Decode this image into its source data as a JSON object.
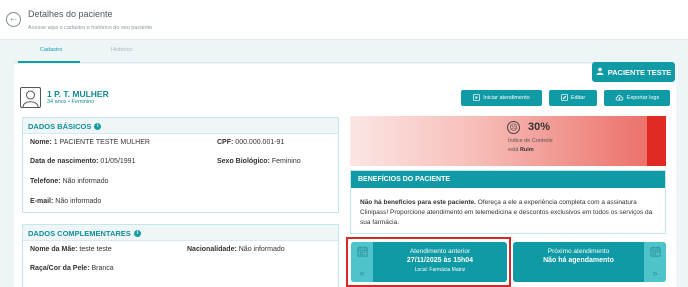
{
  "header": {
    "title": "Detalhes do paciente",
    "subtitle": "Acesse aqui o cadastro e histórico do seu paciente"
  },
  "tabs": [
    {
      "label": "Cadastro",
      "active": true
    },
    {
      "label": "Histórico",
      "active": false
    }
  ],
  "patient": {
    "button_label": "PACIENTE TESTE",
    "name": "1 P. T. MULHER",
    "age_sex": "34 anos • Feminino"
  },
  "actions": {
    "start_label": "Iniciar atendimento",
    "edit_label": "Editar",
    "export_label": "Exportar logs"
  },
  "dados_basicos": {
    "title": "DADOS BÁSICOS",
    "nome_label": "Nome:",
    "nome_value": "1 PACIENTE TESTE MULHER",
    "cpf_label": "CPF:",
    "cpf_value": "000.000.001-91",
    "nascimento_label": "Data de nascimento:",
    "nascimento_value": "01/05/1991",
    "sexo_label": "Sexo Biológico:",
    "sexo_value": "Feminino",
    "telefone_label": "Telefone:",
    "telefone_value": "Não informado",
    "email_label": "E-mail:",
    "email_value": "Não informado"
  },
  "dados_complementares": {
    "title": "DADOS COMPLEMENTARES",
    "mae_label": "Nome da Mãe:",
    "mae_value": "teste teste",
    "nacionalidade_label": "Nacionalidade:",
    "nacionalidade_value": "Não informado",
    "raca_label": "Raça/Cor da Pele:",
    "raca_value": "Branca"
  },
  "control_index": {
    "percent": "30%",
    "label": "Índice de Controle",
    "status_prefix": "está",
    "status": "Ruim",
    "colors": {
      "low": "#fbe6e4",
      "high": "#e02b22"
    }
  },
  "benefits": {
    "title": "BENEFÍCIOS DO PACIENTE",
    "text_bold": "Não há benefícios para este paciente.",
    "text_rest": " Ofereça a ele a experiência completa com a assinatura Clinipass! Proporcione atendimento em telemedicina e descontos exclusivos em todos os serviços da sua farmácia."
  },
  "appointments": {
    "previous": {
      "title": "Atendimento anterior",
      "date": "27/11/2025 às 15h04",
      "location": "Local: Farmácia Matriz"
    },
    "next": {
      "title": "Próximo atendimento",
      "date": "Não há agendamento"
    }
  },
  "icons": {
    "back": "arrow-left-circle",
    "avatar": "user-silhouette",
    "calendar": "calendar",
    "play": "play-circle",
    "edit": "edit",
    "cloud": "cloud-download",
    "face": "sad-face",
    "info": "info-circle"
  },
  "colors": {
    "primary": "#0f9aa5",
    "accent_light": "#4fc3cc",
    "highlight": "#d62828"
  }
}
